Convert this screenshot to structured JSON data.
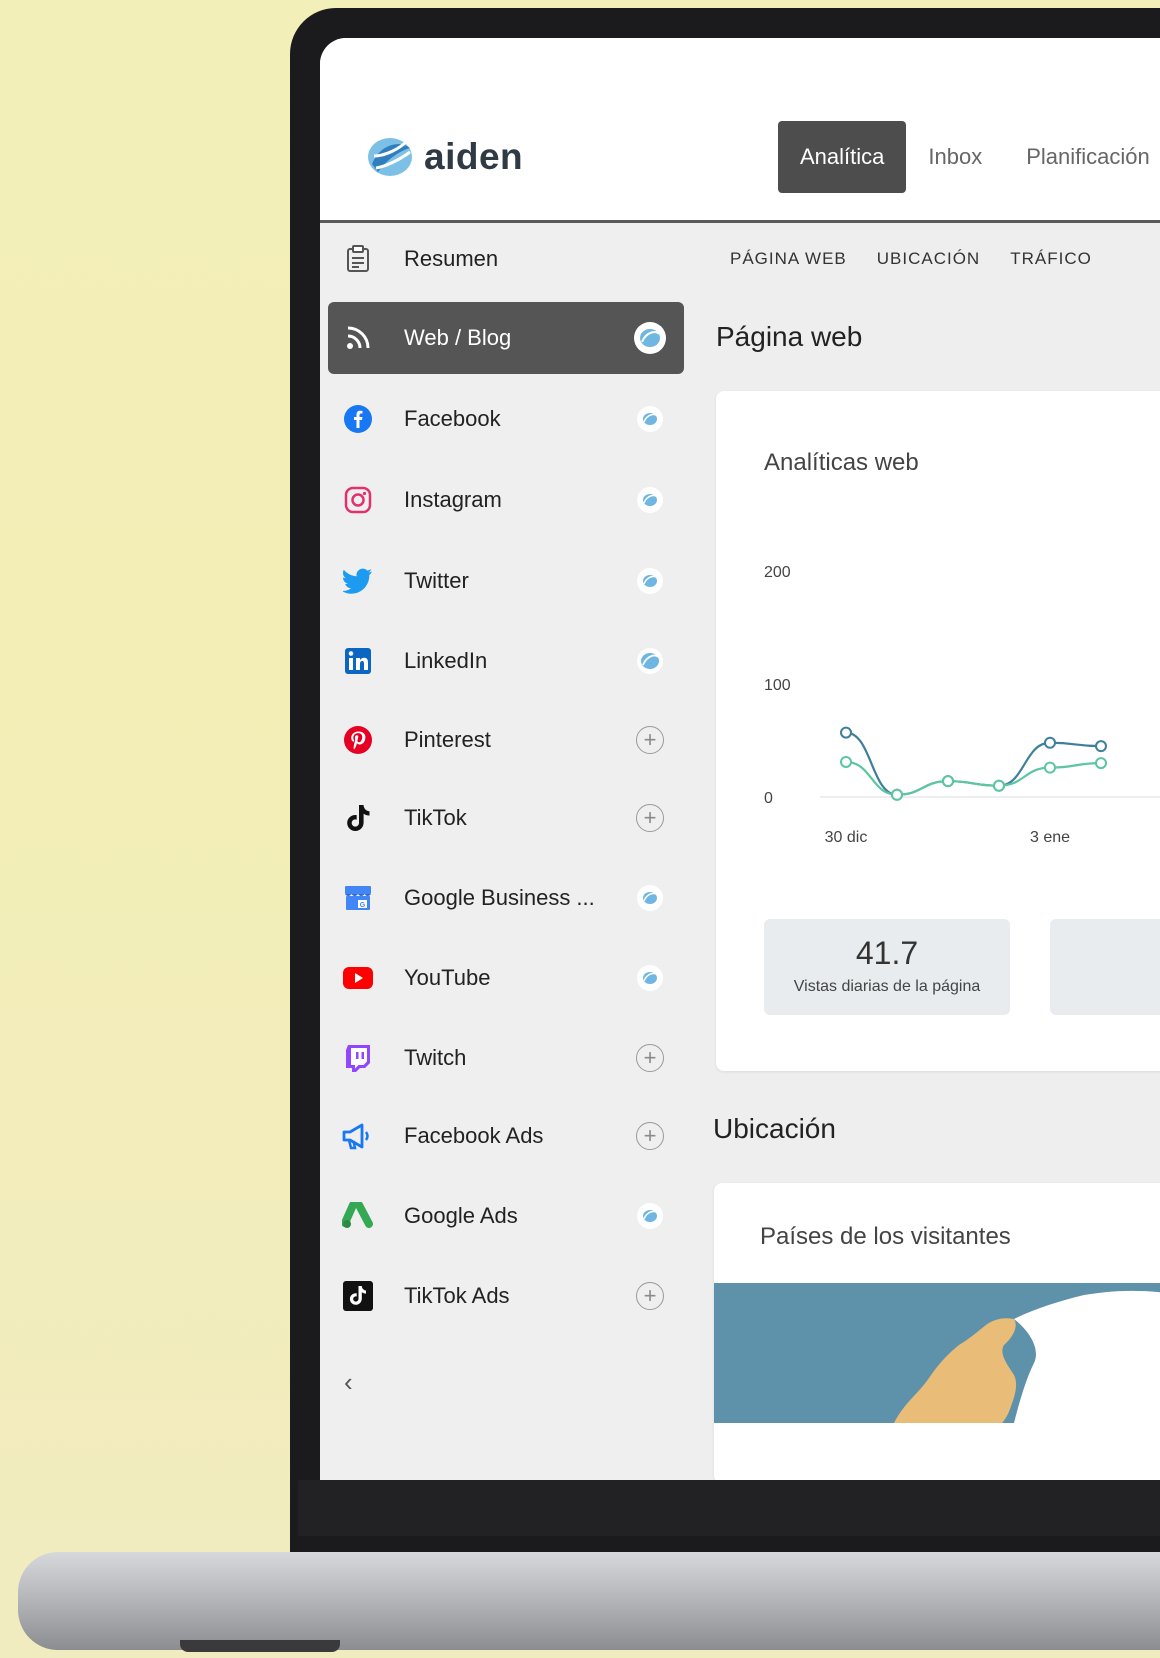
{
  "app": {
    "logo_text": "aiden"
  },
  "nav": {
    "tabs": [
      {
        "label": "Analítica",
        "active": true
      },
      {
        "label": "Inbox",
        "active": false
      },
      {
        "label": "Planificación",
        "active": false
      }
    ]
  },
  "sidebar": {
    "summary": "Resumen",
    "items": [
      {
        "label": "Web / Blog",
        "icon": "rss-icon",
        "state": "connected",
        "active": true
      },
      {
        "label": "Facebook",
        "icon": "facebook-icon",
        "state": "connected"
      },
      {
        "label": "Instagram",
        "icon": "instagram-icon",
        "state": "connected"
      },
      {
        "label": "Twitter",
        "icon": "twitter-icon",
        "state": "connected"
      },
      {
        "label": "LinkedIn",
        "icon": "linkedin-icon",
        "state": "connected"
      },
      {
        "label": "Pinterest",
        "icon": "pinterest-icon",
        "state": "add"
      },
      {
        "label": "TikTok",
        "icon": "tiktok-icon",
        "state": "add"
      },
      {
        "label": "Google Business ...",
        "icon": "google-business-icon",
        "state": "connected"
      },
      {
        "label": "YouTube",
        "icon": "youtube-icon",
        "state": "connected"
      },
      {
        "label": "Twitch",
        "icon": "twitch-icon",
        "state": "add"
      },
      {
        "label": "Facebook Ads",
        "icon": "megaphone-icon",
        "state": "add"
      },
      {
        "label": "Google Ads",
        "icon": "google-ads-icon",
        "state": "connected"
      },
      {
        "label": "TikTok Ads",
        "icon": "tiktok-ads-icon",
        "state": "add"
      }
    ],
    "collapse_glyph": "‹"
  },
  "main": {
    "subtabs": [
      "PÁGINA WEB",
      "UBICACIÓN",
      "TRÁFICO"
    ],
    "section_web": "Página web",
    "card_web_title": "Analíticas web",
    "metric_value": "41.7",
    "metric_label": "Vistas diarias de la página",
    "section_location": "Ubicación",
    "card_location_title": "Países de los visitantes"
  },
  "chart_data": {
    "type": "line",
    "y_ticks": [
      "200",
      "100",
      "0"
    ],
    "x_ticks": [
      "30 dic",
      "3 ene"
    ],
    "ylim": [
      0,
      200
    ],
    "series": [
      {
        "color": "#3f7f9b",
        "values": [
          57,
          2,
          14,
          10,
          48,
          45
        ]
      },
      {
        "color": "#5cc6a0",
        "values": [
          31,
          2,
          14,
          10,
          26,
          30
        ]
      }
    ]
  },
  "colors": {
    "accent": "#4d4d4d",
    "connected_badge": "#4ea5d9"
  }
}
